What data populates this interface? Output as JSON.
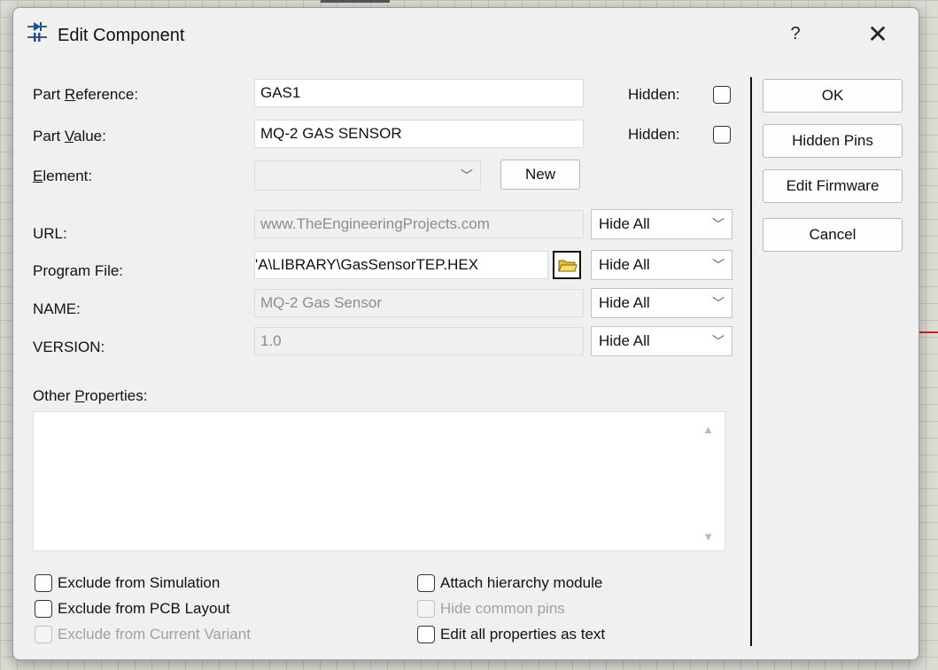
{
  "dialog": {
    "title": "Edit Component",
    "help": "?",
    "close": "✕"
  },
  "fields": {
    "part_reference": {
      "label_pre": "Part ",
      "label_u": "R",
      "label_post": "eference:",
      "value": "GAS1",
      "hidden_label": "Hidden:",
      "hidden": false
    },
    "part_value": {
      "label_pre": "Part ",
      "label_u": "V",
      "label_post": "alue:",
      "value": "MQ-2 GAS SENSOR",
      "hidden_label": "Hidden:",
      "hidden": false
    },
    "element": {
      "label_u": "E",
      "label_post": "lement:",
      "value": "",
      "new_button": "New"
    },
    "url": {
      "label": "URL:",
      "value": "www.TheEngineeringProjects.com",
      "visibility": "Hide All"
    },
    "program_file": {
      "label": "Program File:",
      "value": "'A\\LIBRARY\\GasSensorTEP.HEX",
      "visibility": "Hide All"
    },
    "name": {
      "label": "NAME:",
      "value": "MQ-2 Gas Sensor",
      "visibility": "Hide All"
    },
    "version": {
      "label": "VERSION:",
      "value": "1.0",
      "visibility": "Hide All"
    }
  },
  "other_properties": {
    "label_pre": "Other ",
    "label_u": "P",
    "label_post": "roperties:",
    "value": ""
  },
  "buttons": {
    "ok": "OK",
    "hidden_pins": "Hidden Pins",
    "edit_firmware": "Edit Firmware",
    "cancel": "Cancel"
  },
  "options": {
    "exclude_simulation": {
      "label": "Exclude from Simulation",
      "checked": false,
      "enabled": true
    },
    "exclude_pcb": {
      "label": "Exclude from PCB Layout",
      "checked": false,
      "enabled": true
    },
    "exclude_variant": {
      "label": "Exclude from Current Variant",
      "checked": false,
      "enabled": false
    },
    "attach_hierarchy": {
      "label": "Attach hierarchy module",
      "checked": false,
      "enabled": true
    },
    "hide_common_pins": {
      "label": "Hide common pins",
      "checked": false,
      "enabled": false
    },
    "edit_as_text": {
      "label": "Edit all properties as text",
      "checked": false,
      "enabled": true
    }
  },
  "colors": {
    "dialog_bg": "#f0f0f0",
    "grid_bg": "#dcdcd4",
    "accent_red": "#d62020"
  }
}
